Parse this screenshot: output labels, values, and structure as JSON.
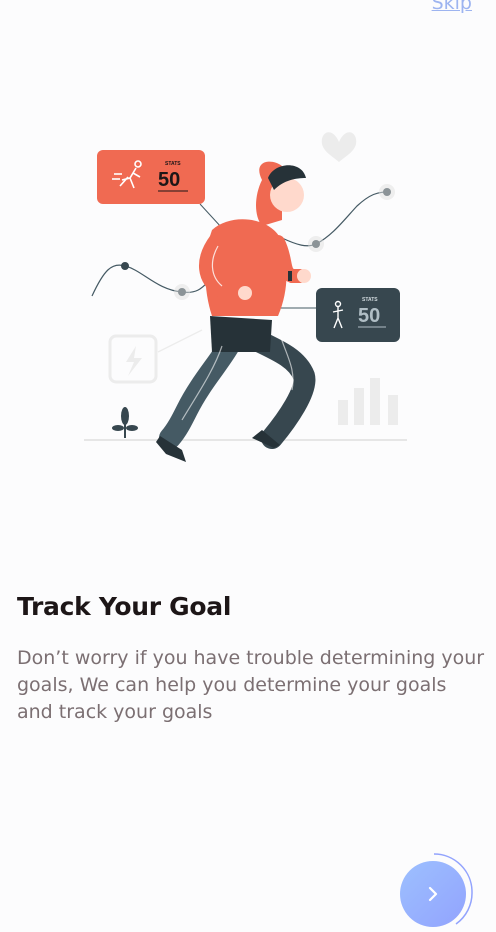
{
  "header": {
    "skip_label": "Skip"
  },
  "illustration": {
    "stats_card_1": {
      "caption": "STATS",
      "value": "50"
    },
    "stats_card_2": {
      "caption": "STATS",
      "value": "50"
    }
  },
  "onboarding": {
    "title": "Track Your Goal",
    "description": "Don’t worry if you have trouble determining your goals, We can help you determine your goals and track your goals"
  },
  "next_button": {
    "icon": "chevron-right-icon"
  },
  "colors": {
    "brand_gradient_start": "#9DC0FF",
    "brand_gradient_end": "#92A3FD",
    "title": "#1D1617",
    "body_text": "#7B6F72",
    "hoodie": "#F06A52",
    "pants": "#37474F"
  }
}
